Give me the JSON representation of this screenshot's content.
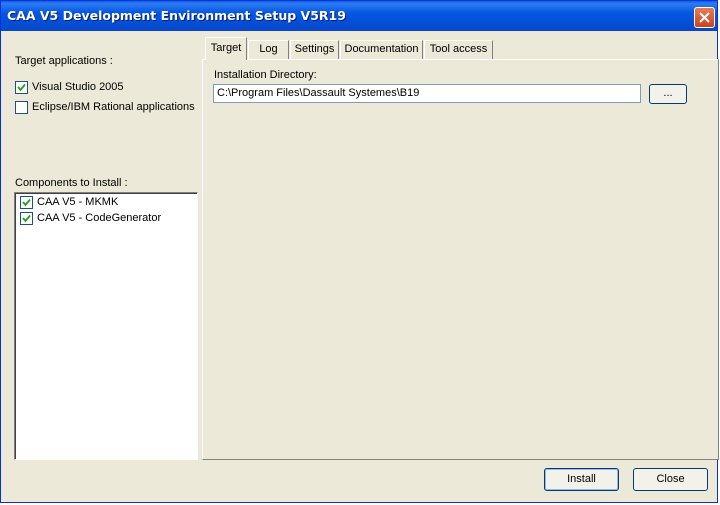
{
  "window": {
    "title": "CAA V5 Development Environment Setup V5R19"
  },
  "left": {
    "target_label": "Target applications :",
    "targets": [
      {
        "label": "Visual Studio 2005",
        "checked": true
      },
      {
        "label": "Eclipse/IBM Rational applications",
        "checked": false
      }
    ],
    "components_label": "Components to Install :",
    "components": [
      {
        "label": "CAA V5 - MKMK",
        "checked": true
      },
      {
        "label": "CAA V5 - CodeGenerator",
        "checked": true
      }
    ]
  },
  "tabs": [
    "Target",
    "Log",
    "Settings",
    "Documentation",
    "Tool access"
  ],
  "active_tab": "Target",
  "target_panel": {
    "dir_label": "Installation Directory:",
    "dir_value": "C:\\Program Files\\Dassault Systemes\\B19",
    "browse_label": "..."
  },
  "footer": {
    "install_label": "Install",
    "close_label": "Close"
  }
}
